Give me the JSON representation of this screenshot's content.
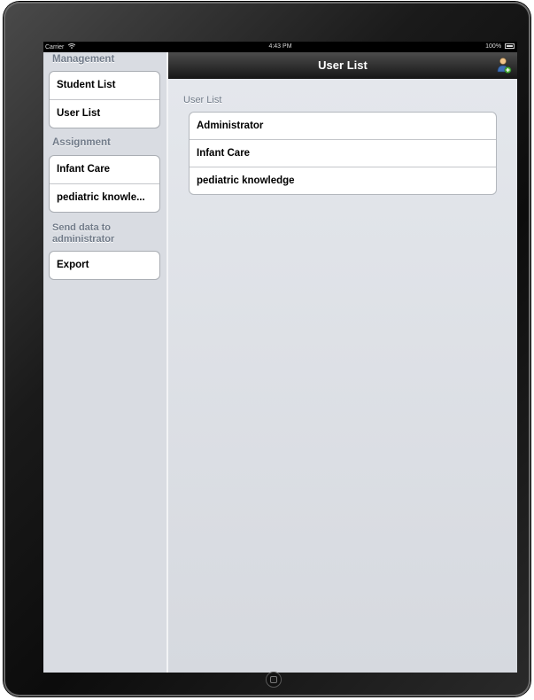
{
  "status_bar": {
    "carrier": "Carrier",
    "time": "4:43 PM",
    "battery": "100%"
  },
  "sidebar": {
    "sections": [
      {
        "header": "Management",
        "items": [
          "Student List",
          "User List"
        ]
      },
      {
        "header": "Assignment",
        "items": [
          "Infant Care",
          "pediatric knowle..."
        ]
      },
      {
        "header_lines": [
          "Send data to",
          "administrator"
        ],
        "items": [
          "Export"
        ]
      }
    ]
  },
  "navbar": {
    "title": "User List",
    "right_icon": "user-add-icon"
  },
  "detail": {
    "section_header": "User List",
    "rows": [
      "Administrator",
      "Infant Care",
      "pediatric knowledge"
    ]
  },
  "colors": {
    "sidebar_bg": "#d9dce2",
    "section_header_text": "#717b89",
    "navbar_top": "#4c4c4c",
    "navbar_bottom": "#161616"
  }
}
